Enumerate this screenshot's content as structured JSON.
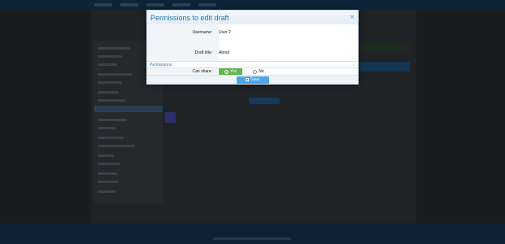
{
  "modal": {
    "title": "Permissions to edit draft",
    "close_glyph": "×",
    "fields": [
      {
        "label": "Username:",
        "value": "User 2"
      },
      {
        "label": "Draft title:",
        "value": "About"
      }
    ],
    "section_title": "Permissions",
    "section_chevron": "⌄",
    "can_share": {
      "label": "Can share:",
      "yes_label": "Yes",
      "no_label": "No",
      "selected": "Yes"
    },
    "save_label": "Save"
  },
  "colors": {
    "title_blue": "#2577b1",
    "accent_blue": "#47a7eb",
    "yes_green": "#63b553"
  },
  "icons": {
    "close": "close-icon",
    "save": "save-icon",
    "chevron": "chevron-down-icon"
  }
}
